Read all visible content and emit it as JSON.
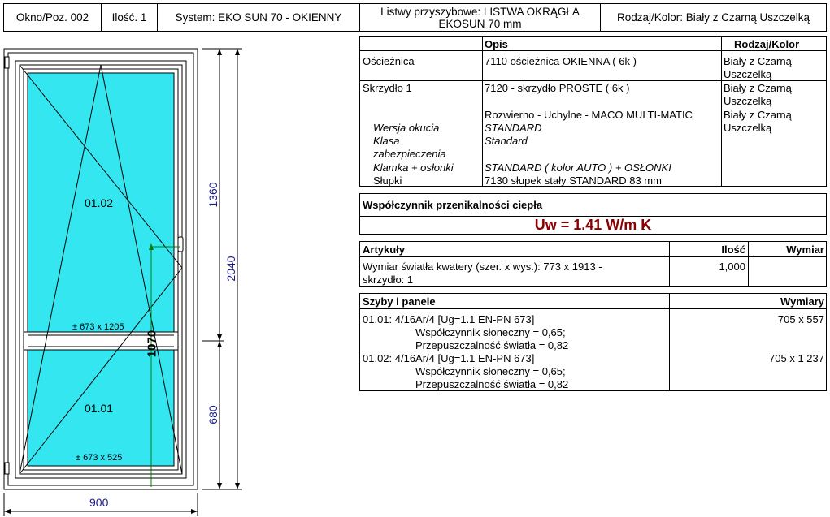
{
  "header": {
    "position": "Okno/Poz. 002",
    "quantity": "Ilość. 1",
    "system": "System: EKO SUN  70  - OKIENNY",
    "listwy_line1": "Listwy przyszybowe: LISTWA  OKRĄGŁA",
    "listwy_line2": "EKOSUN  70 mm",
    "color": "Rodzaj/Kolor: Biały z Czarną Uszczelką"
  },
  "drawing": {
    "pane_upper": "01.02",
    "pane_lower": "01.01",
    "dim_upper": "± 673 x 1205",
    "dim_lower": "± 673 x 525",
    "height_total": "2040",
    "height_upper": "1360",
    "height_lower": "680",
    "handle_height": "1070",
    "width": "900"
  },
  "desc_table": {
    "col_opis": "Opis",
    "col_rodzaj": "Rodzaj/Kolor",
    "r1_name": "Ościeżnica",
    "r1_opis": "7110 ościeżnica  OKIENNA ( 6k )",
    "r1_kolor1": "Biały z Czarną",
    "r1_kolor2": "Uszczelką",
    "r2_name": "Skrzydło 1",
    "r2_opis": "7120 - skrzydło PROSTE ( 6k )",
    "r2_kolor1": "Biały z Czarną",
    "r2_kolor2": "Uszczelką",
    "r3_opis": "Rozwierno - Uchylne - MACO  MULTI-MATIC",
    "r3_kolor1": "Biały z Czarną",
    "r3_kolor2": "Uszczelką",
    "wersja_label": "Wersja okucia",
    "wersja_val": "STANDARD",
    "klasa_label1": "Klasa",
    "klasa_label2": "zabezpieczenia",
    "klasa_val": "Standard",
    "klamka_label": "Klamka + osłonki",
    "klamka_val": "STANDARD  ( kolor AUTO ) + OSŁONKI",
    "slupki_label": "Słupki",
    "slupki_val": "7130 słupek stały STANDARD 83 mm"
  },
  "thermal": {
    "title": "Współczynnik przenikalności ciepła",
    "value": "Uw = 1.41 W/m K",
    "superscript": "2"
  },
  "articles": {
    "col_name": "Artykuły",
    "col_qty": "Ilość",
    "col_dim": "Wymiar",
    "row_line1": "Wymiar światła kwatery (szer. x wys.): 773 x 1913 -",
    "row_line2": "skrzydło: 1",
    "row_qty": "1,000"
  },
  "glass": {
    "col_name": "Szyby i panele",
    "col_dim": "Wymiary",
    "g1_line1": "01.01: 4/16Ar/4 [Ug=1.1 EN-PN 673]",
    "g1_line2": "Współczynnik słoneczny = 0,65;",
    "g1_line3": "Przepuszczalność światła = 0,82",
    "g1_dim": "705 x 557",
    "g2_line1": "01.02: 4/16Ar/4 [Ug=1.1 EN-PN 673]",
    "g2_line2": "Współczynnik słoneczny = 0,65;",
    "g2_line3": "Przepuszczalność światła = 0,82",
    "g2_dim": "705 x 1 237"
  },
  "colors": {
    "glass": "#33e6f0",
    "accent_red": "#8b0000",
    "dim_blue": "#1a1a8c",
    "green": "#008000"
  }
}
